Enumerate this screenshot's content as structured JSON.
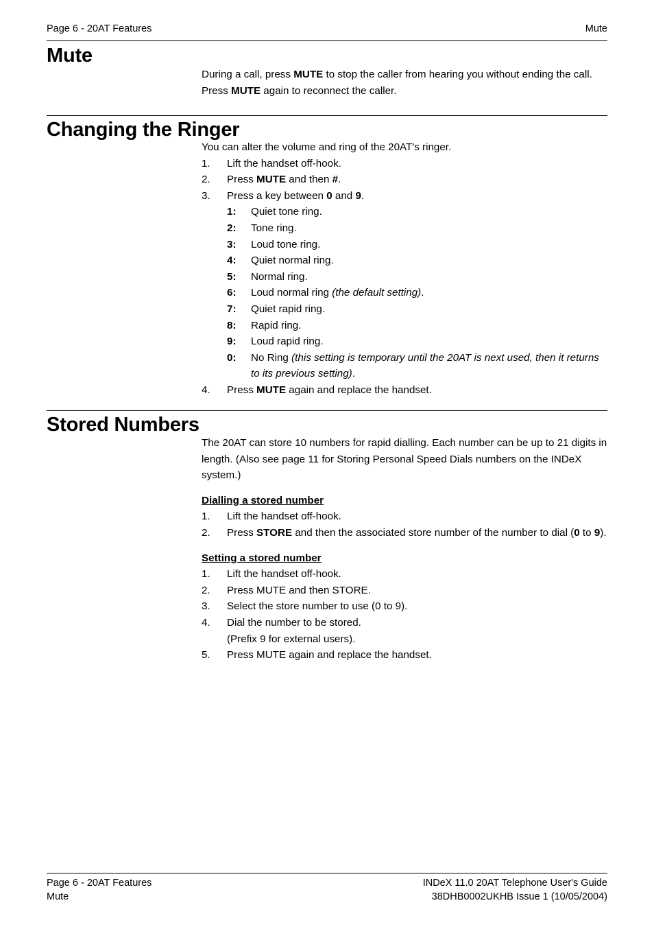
{
  "running_header": {
    "left": "Page 6 - 20AT Features",
    "right": "Mute"
  },
  "sections": {
    "mute": {
      "title": "Mute",
      "paragraph_1_pre": "During a call, press ",
      "paragraph_1_kw1": "MUTE",
      "paragraph_1_mid": " to stop the caller from hearing you without ending the call. Press ",
      "paragraph_1_kw2": "MUTE",
      "paragraph_1_post": " again to reconnect the caller."
    },
    "ringer": {
      "title": "Changing the Ringer",
      "intro": "You can alter the volume and ring of the 20AT's ringer.",
      "steps": [
        {
          "marker": "1.",
          "text": "Lift the handset off-hook."
        },
        {
          "marker": "2.",
          "pre": "Press ",
          "kw1": "MUTE",
          "mid": " and then ",
          "kw2": "#",
          "post": "."
        },
        {
          "marker": "3.",
          "pre": "Press a key between ",
          "kw1": "0",
          "mid": " and ",
          "kw2": "9",
          "post": "."
        },
        {
          "marker": "4.",
          "pre": "Press ",
          "kw1": "MUTE",
          "post": " again and replace the handset."
        }
      ],
      "options": [
        {
          "marker": "1:",
          "text": "Quiet tone ring."
        },
        {
          "marker": "2:",
          "text": "Tone ring."
        },
        {
          "marker": "3:",
          "text": "Loud tone ring."
        },
        {
          "marker": "4:",
          "text": "Quiet normal ring."
        },
        {
          "marker": "5:",
          "text": "Normal ring."
        },
        {
          "marker": "6:",
          "pre": "Loud normal ring ",
          "em": "(the default setting)",
          "post": "."
        },
        {
          "marker": "7:",
          "text": "Quiet rapid ring."
        },
        {
          "marker": "8:",
          "text": "Rapid ring."
        },
        {
          "marker": "9:",
          "text": "Loud rapid ring."
        },
        {
          "marker": "0:",
          "pre": "No Ring ",
          "em": "(this setting is temporary until the 20AT is next used, then it returns to its previous setting)",
          "post": "."
        }
      ]
    },
    "stored": {
      "title": "Stored Numbers",
      "intro": "The 20AT can store 10 numbers for rapid dialling. Each number can be up to 21 digits in length. (Also see page 11 for Storing Personal Speed Dials numbers on the INDeX system.)",
      "dialling": {
        "heading": "Dialling a stored number",
        "steps": [
          {
            "marker": "1.",
            "text": "Lift the handset off-hook."
          },
          {
            "marker": "2.",
            "pre": "Press ",
            "kw1": "STORE",
            "mid": " and then the associated store number of the number to dial (",
            "kw2": "0",
            "mid2": " to ",
            "kw3": "9",
            "post": ")."
          }
        ]
      },
      "setting": {
        "heading": "Setting a stored number",
        "steps": [
          {
            "marker": "1.",
            "text": "Lift the handset off-hook."
          },
          {
            "marker": "2.",
            "text": "Press MUTE and then STORE."
          },
          {
            "marker": "3.",
            "text": "Select the store number to use (0 to 9)."
          },
          {
            "marker": "4.",
            "text": "Dial the number to be stored.",
            "text2": "(Prefix 9 for external users)."
          },
          {
            "marker": "5.",
            "text": "Press MUTE again and replace the handset."
          }
        ]
      }
    }
  },
  "footer": {
    "left_line1": "Page 6 - 20AT Features",
    "left_line2": "Mute",
    "right_line1": "INDeX 11.0 20AT Telephone User's Guide",
    "right_line2": "38DHB0002UKHB Issue 1 (10/05/2004)"
  }
}
